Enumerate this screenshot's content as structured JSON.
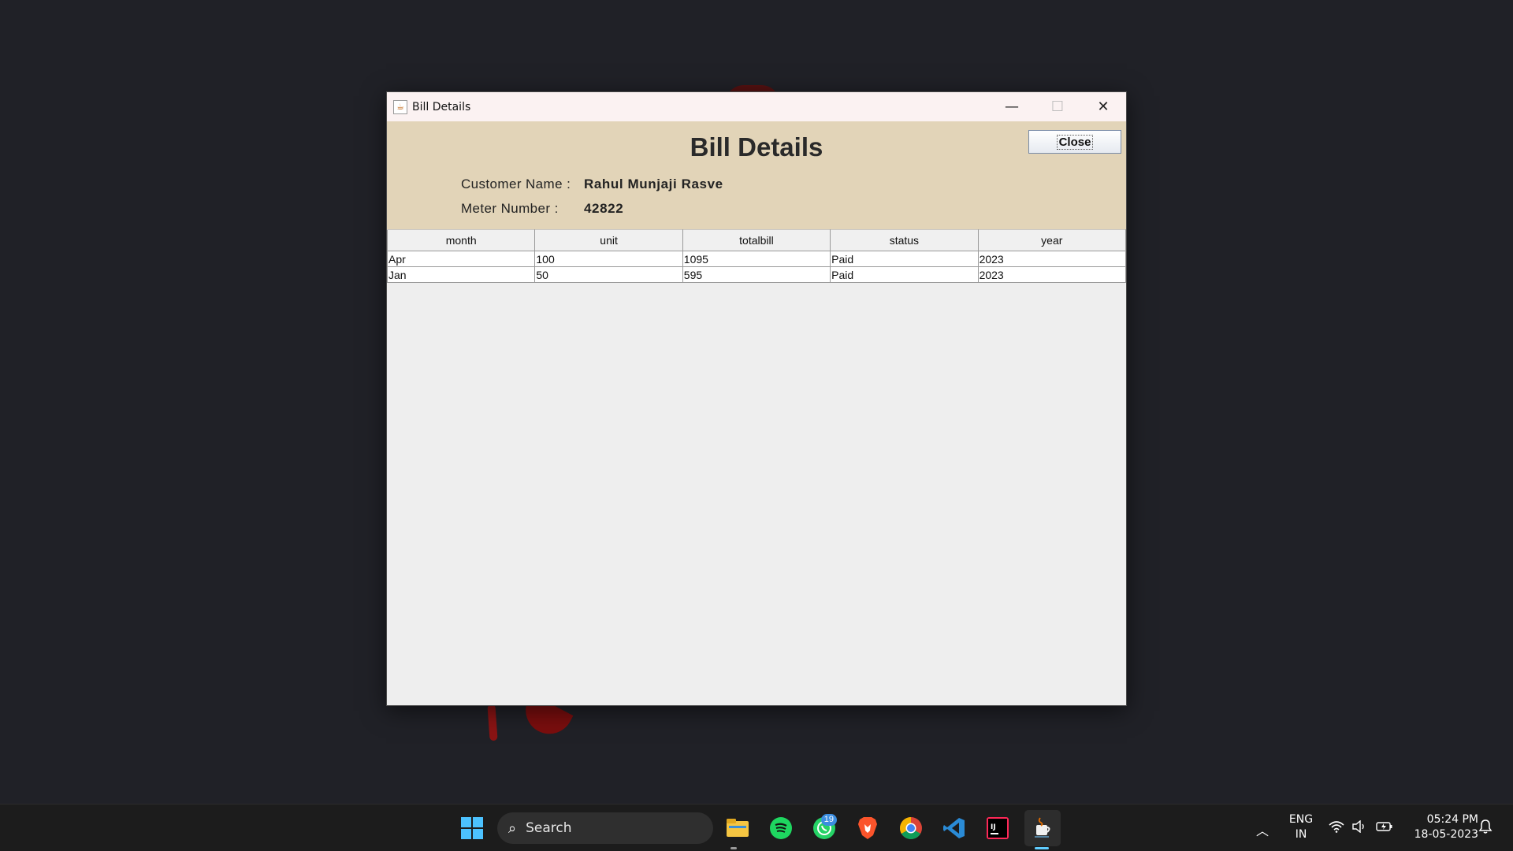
{
  "window": {
    "title": "Bill Details",
    "controls": {
      "minimize": "—",
      "maximize": "☐",
      "close": "✕"
    }
  },
  "header": {
    "heading": "Bill Details",
    "close_label": "Close",
    "customer_label": "Customer Name :",
    "customer_value": "Rahul Munjaji Rasve",
    "meter_label": "Meter Number :",
    "meter_value": "42822"
  },
  "table": {
    "columns": [
      "month",
      "unit",
      "totalbill",
      "status",
      "year"
    ],
    "rows": [
      [
        "Apr",
        "100",
        "1095",
        "Paid",
        "2023"
      ],
      [
        "Jan",
        "50",
        "595",
        "Paid",
        "2023"
      ]
    ]
  },
  "taskbar": {
    "search_label": "Search",
    "whatsapp_badge": "19",
    "lang_line1": "ENG",
    "lang_line2": "IN",
    "time": "05:24 PM",
    "date": "18-05-2023",
    "icons": [
      "windows-start-icon",
      "file-explorer-icon",
      "spotify-icon",
      "whatsapp-icon",
      "brave-icon",
      "chrome-icon",
      "vscode-icon",
      "intellij-icon",
      "java-icon"
    ]
  },
  "colors": {
    "header_bg": "#e2d4b8",
    "accent": "#60cdff"
  }
}
